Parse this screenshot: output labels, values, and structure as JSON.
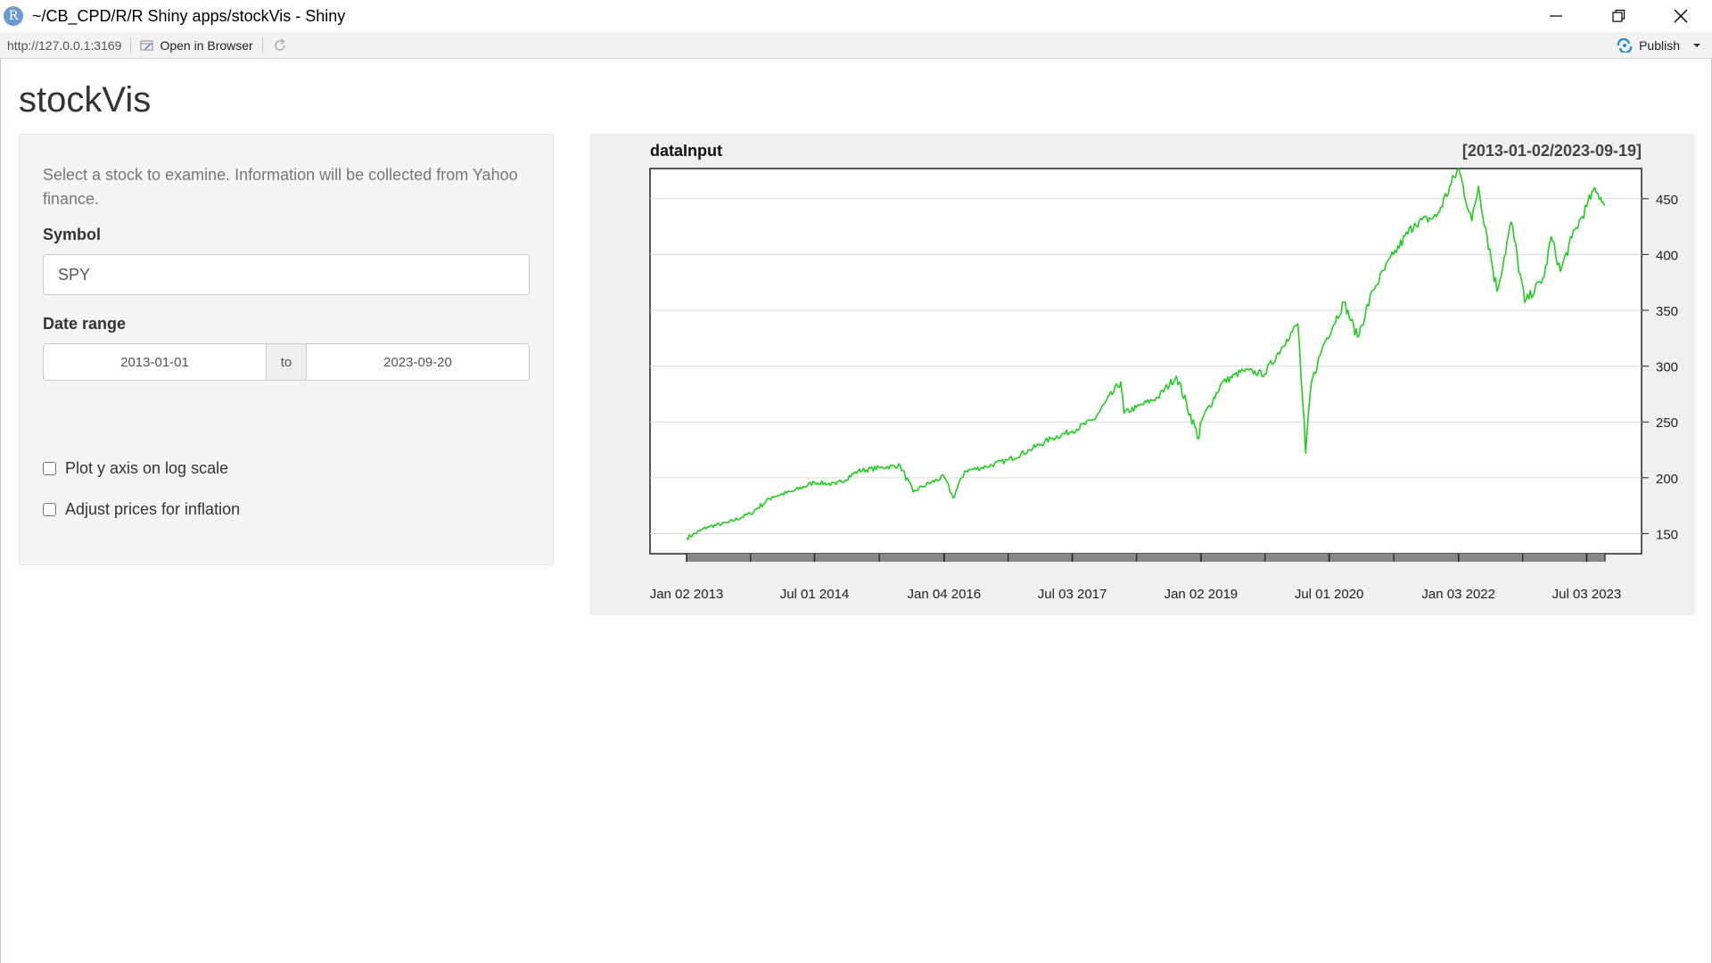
{
  "window": {
    "title": "~/CB_CPD/R/R Shiny apps/stockVis - Shiny",
    "app_icon_letter": "R"
  },
  "toolbar": {
    "url": "http://127.0.0.1:3169",
    "open_in_browser": "Open in Browser",
    "publish": "Publish"
  },
  "app": {
    "title": "stockVis",
    "help_text": "Select a stock to examine. Information will be collected from Yahoo finance.",
    "symbol_label": "Symbol",
    "symbol_value": "SPY",
    "date_label": "Date range",
    "date_start": "2013-01-01",
    "date_separator": "to",
    "date_end": "2023-09-20",
    "log_scale_label": "Plot y axis on log scale",
    "log_scale_checked": false,
    "inflation_label": "Adjust prices for inflation",
    "inflation_checked": false
  },
  "colors": {
    "series": "#22cc22",
    "panel_background": "#f0f0f0"
  },
  "chart_data": {
    "type": "line",
    "title": "dataInput",
    "subtitle": "[2013-01-02/2023-09-19]",
    "xlabel": "",
    "ylabel": "",
    "x_tick_labels": [
      "Jan 02 2013",
      "Jul 01 2014",
      "Jan 04 2016",
      "Jul 03 2017",
      "Jan 02 2019",
      "Jul 01 2020",
      "Jan 03 2022",
      "Jul 03 2023"
    ],
    "x_tick_dates": [
      "2013-01-02",
      "2014-07-01",
      "2016-01-04",
      "2017-07-03",
      "2019-01-02",
      "2020-07-01",
      "2022-01-03",
      "2023-07-03"
    ],
    "y_ticks": [
      150,
      200,
      250,
      300,
      350,
      400,
      450
    ],
    "ylim": [
      132,
      477
    ],
    "xlim": [
      "2013-01-02",
      "2023-09-19"
    ],
    "y_axis_side": "right",
    "grid": true,
    "series": [
      {
        "x": [
          "2013-01-02",
          "2013-04-01",
          "2013-07-01",
          "2013-10-01",
          "2014-01-02",
          "2014-04-01",
          "2014-07-01",
          "2014-10-01",
          "2015-01-02",
          "2015-04-01",
          "2015-07-01",
          "2015-08-25",
          "2015-10-01",
          "2016-01-04",
          "2016-02-11",
          "2016-04-01",
          "2016-07-01",
          "2016-10-03",
          "2017-01-03",
          "2017-04-03",
          "2017-07-03",
          "2017-10-02",
          "2018-01-26",
          "2018-02-08",
          "2018-04-02",
          "2018-07-02",
          "2018-09-20",
          "2018-12-24",
          "2019-01-02",
          "2019-04-01",
          "2019-07-01",
          "2019-10-01",
          "2020-01-02",
          "2020-02-19",
          "2020-03-23",
          "2020-04-15",
          "2020-06-08",
          "2020-09-02",
          "2020-10-30",
          "2021-01-04",
          "2021-04-01",
          "2021-07-01",
          "2021-10-01",
          "2022-01-03",
          "2022-03-01",
          "2022-03-29",
          "2022-06-16",
          "2022-08-16",
          "2022-10-12",
          "2023-01-03",
          "2023-02-02",
          "2023-03-13",
          "2023-05-01",
          "2023-07-03",
          "2023-07-31",
          "2023-09-01",
          "2023-09-19"
        ],
        "values": [
          146,
          156,
          160,
          168,
          183,
          188,
          196,
          194,
          206,
          209,
          211,
          187,
          192,
          201,
          182,
          206,
          210,
          216,
          225,
          235,
          242,
          252,
          286,
          258,
          263,
          272,
          291,
          235,
          250,
          285,
          296,
          293,
          324,
          338,
          222,
          284,
          320,
          357,
          326,
          368,
          400,
          428,
          434,
          477,
          430,
          461,
          367,
          429,
          357,
          380,
          416,
          385,
          415,
          443,
          457,
          451,
          444
        ]
      }
    ]
  }
}
